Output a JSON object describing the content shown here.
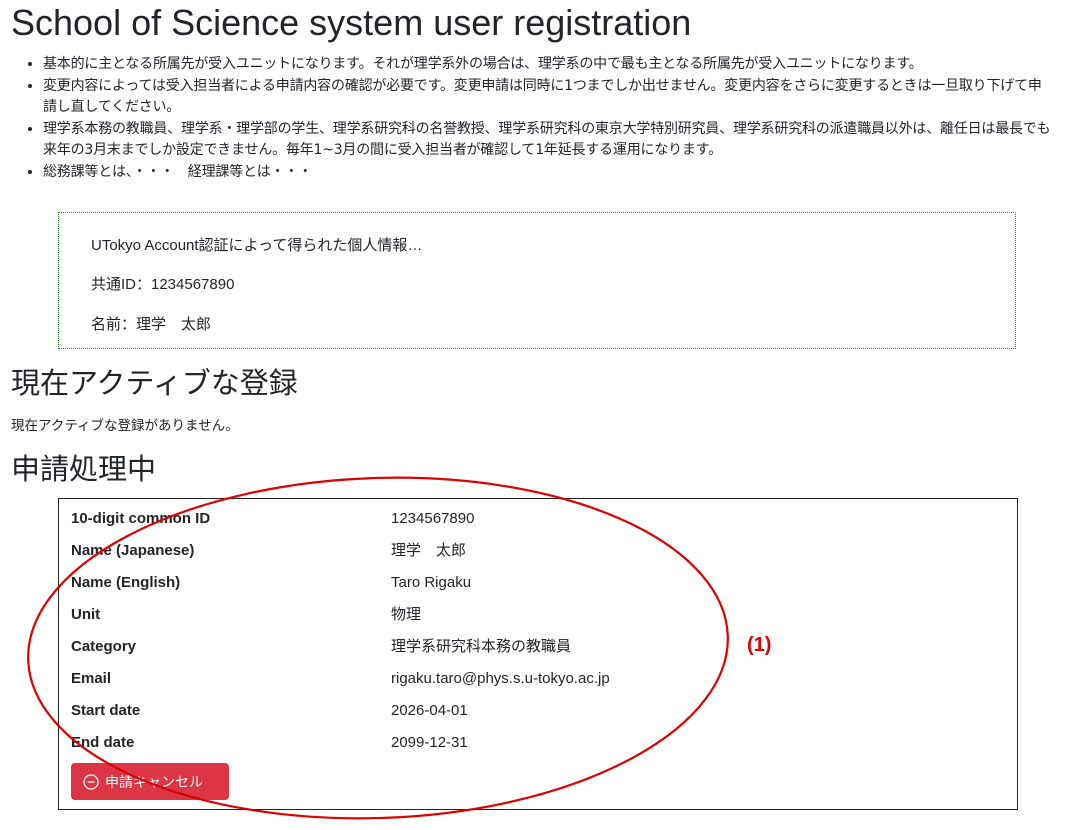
{
  "page": {
    "title": "School of Science system user registration"
  },
  "notes": [
    "基本的に主となる所属先が受入ユニットになります。それが理学系外の場合は、理学系の中で最も主となる所属先が受入ユニットになります。",
    "変更内容によっては受入担当者による申請内容の確認が必要です。変更申請は同時に1つまでしか出せません。変更内容をさらに変更するときは一旦取り下げて申請し直してください。",
    "理学系本務の教職員、理学系・理学部の学生、理学系研究科の名誉教授、理学系研究科の東京大学特別研究員、理学系研究科の派遣職員以外は、離任日は最長でも来年の3月末までしか設定できません。毎年1~3月の間に受入担当者が確認して1年延長する運用になります。",
    "総務課等とは、・・・　経理課等とは・・・"
  ],
  "auth_box": {
    "intro": "UTokyo Account認証によって得られた個人情報…",
    "id_line": "共通ID：1234567890",
    "name_line": "名前：理学　太郎"
  },
  "active": {
    "heading": "現在アクティブな登録",
    "empty_text": "現在アクティブな登録がありません。"
  },
  "pending": {
    "heading": "申請処理中",
    "fields": [
      {
        "label": "10-digit common ID",
        "value": "1234567890"
      },
      {
        "label": "Name (Japanese)",
        "value": "理学　太郎"
      },
      {
        "label": "Name (English)",
        "value": "Taro Rigaku"
      },
      {
        "label": "Unit",
        "value": "物理"
      },
      {
        "label": "Category",
        "value": "理学系研究科本務の教職員"
      },
      {
        "label": "Email",
        "value": "rigaku.taro@phys.s.u-tokyo.ac.jp"
      },
      {
        "label": "Start date",
        "value": "2026-04-01"
      },
      {
        "label": "End date",
        "value": "2099-12-31"
      }
    ],
    "cancel_label": "申請キャンセル",
    "cancel_icon": "minus-circle-icon"
  },
  "annotation": {
    "label": "(1)",
    "color": "#e00000"
  },
  "colors": {
    "danger": "#dc3545",
    "auth_border": "#2e8b2e",
    "text": "#212529"
  }
}
